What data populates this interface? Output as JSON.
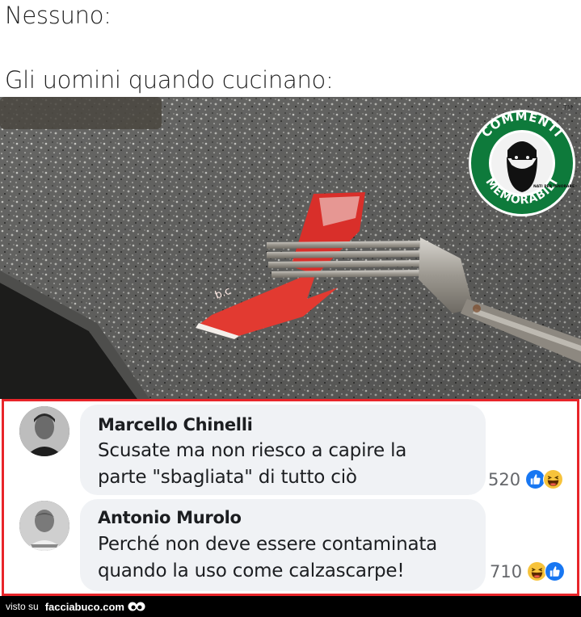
{
  "meme": {
    "line1": "Nessuno:",
    "line2": "Gli uomini quando cucinano:"
  },
  "photo": {
    "packet_text": "b.c",
    "logo": {
      "top_text": "COMMENTI",
      "bottom_text": "MEMORABILI",
      "tm": "TM",
      "center_text": "NATI PER IGNORARE"
    }
  },
  "comments": [
    {
      "name": "Marcello Chinelli",
      "line1": "Scusate ma non riesco a capire la",
      "line2": "parte \"sbagliata\" di tutto ciò",
      "reaction_count": "520",
      "reaction_icons": [
        "like-icon",
        "laugh-icon"
      ]
    },
    {
      "name": "Antonio Murolo",
      "line1": "Perché non deve essere contaminata",
      "line2": "quando la uso come calzascarpe!",
      "reaction_count": "710",
      "reaction_icons": [
        "laugh-icon",
        "like-icon"
      ]
    }
  ],
  "footer": {
    "label": "visto su",
    "site": "facciabuco.com"
  },
  "colors": {
    "frame_red": "#e8252a",
    "bubble_bg": "#f0f2f5",
    "like_blue": "#1877f2",
    "logo_green": "#0e7a3b"
  }
}
